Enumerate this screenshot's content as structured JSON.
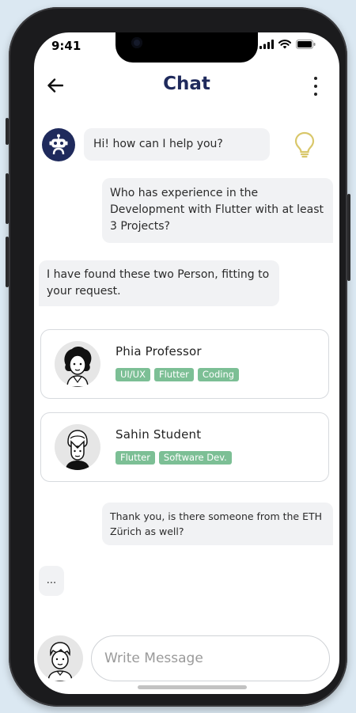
{
  "status_bar": {
    "time": "9:41"
  },
  "header": {
    "title": "Chat"
  },
  "messages": [
    {
      "text": "Hi! how can I help you?"
    },
    {
      "text": "Who has experience in the Development with Flutter with at least 3 Projects?"
    },
    {
      "text": "I have found these two Person, fitting to your request."
    },
    {
      "text": "Thank you, is there someone from the ETH Zürich as well?"
    },
    {
      "text": "..."
    }
  ],
  "people": [
    {
      "name": "Phia Professor",
      "tags": [
        "UI/UX",
        "Flutter",
        "Coding"
      ]
    },
    {
      "name": "Sahin Student",
      "tags": [
        "Flutter",
        "Software Dev."
      ]
    }
  ],
  "composer": {
    "placeholder": "Write Message"
  },
  "colors": {
    "accent": "#1f2a5c",
    "tag": "#7cbf95",
    "bubble": "#f1f2f4",
    "bulb": "#d9c76a"
  },
  "icons": [
    "back-arrow-icon",
    "more-vert-icon",
    "robot-icon",
    "lightbulb-icon",
    "signal-icon",
    "wifi-icon",
    "battery-icon"
  ]
}
